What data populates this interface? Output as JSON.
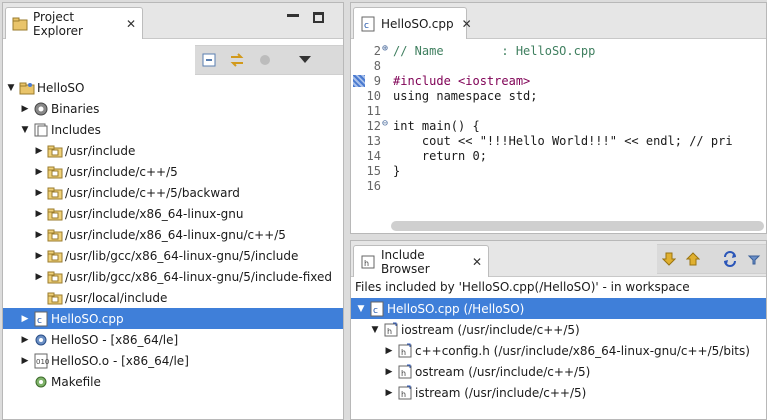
{
  "project_explorer": {
    "title": "Project Explorer",
    "tree": [
      {
        "label": "HelloSO",
        "arrow": "▼",
        "icon": "project-folder-icon",
        "depth": 0
      },
      {
        "label": "Binaries",
        "arrow": "▶",
        "icon": "binaries-icon",
        "depth": 1
      },
      {
        "label": "Includes",
        "arrow": "▼",
        "icon": "includes-icon",
        "depth": 1
      },
      {
        "label": "/usr/include",
        "arrow": "▶",
        "icon": "include-folder-icon",
        "depth": 2
      },
      {
        "label": "/usr/include/c++/5",
        "arrow": "▶",
        "icon": "include-folder-icon",
        "depth": 2
      },
      {
        "label": "/usr/include/c++/5/backward",
        "arrow": "▶",
        "icon": "include-folder-icon",
        "depth": 2
      },
      {
        "label": "/usr/include/x86_64-linux-gnu",
        "arrow": "▶",
        "icon": "include-folder-icon",
        "depth": 2
      },
      {
        "label": "/usr/include/x86_64-linux-gnu/c++/5",
        "arrow": "▶",
        "icon": "include-folder-icon",
        "depth": 2
      },
      {
        "label": "/usr/lib/gcc/x86_64-linux-gnu/5/include",
        "arrow": "▶",
        "icon": "include-folder-icon",
        "depth": 2
      },
      {
        "label": "/usr/lib/gcc/x86_64-linux-gnu/5/include-fixed",
        "arrow": "▶",
        "icon": "include-folder-icon",
        "depth": 2
      },
      {
        "label": "/usr/local/include",
        "arrow": "",
        "icon": "include-folder-icon",
        "depth": 2
      },
      {
        "label": "HelloSO.cpp",
        "arrow": "▶",
        "icon": "cpp-file-icon",
        "depth": 1,
        "selected": true
      },
      {
        "label": "HelloSO - [x86_64/le]",
        "arrow": "▶",
        "icon": "binary-gear-icon",
        "depth": 1
      },
      {
        "label": "HelloSO.o - [x86_64/le]",
        "arrow": "▶",
        "icon": "object-file-icon",
        "depth": 1
      },
      {
        "label": "Makefile",
        "arrow": "",
        "icon": "makefile-icon",
        "depth": 1
      }
    ]
  },
  "editor": {
    "tab_title": "HelloSO.cpp",
    "lines": [
      {
        "num": "2",
        "fold": "⊕",
        "text": "// Name        : HelloSO.cpp"
      },
      {
        "num": "8",
        "fold": "",
        "text": ""
      },
      {
        "num": "9",
        "fold": "",
        "text": "#include <iostream>"
      },
      {
        "num": "10",
        "fold": "",
        "text": "using namespace std;"
      },
      {
        "num": "11",
        "fold": "",
        "text": ""
      },
      {
        "num": "12",
        "fold": "⊖",
        "text": "int main() {"
      },
      {
        "num": "13",
        "fold": "",
        "text": "    cout << \"!!!Hello World!!!\" << endl; // pri"
      },
      {
        "num": "14",
        "fold": "",
        "text": "    return 0;"
      },
      {
        "num": "15",
        "fold": "",
        "text": "}"
      },
      {
        "num": "16",
        "fold": "",
        "text": ""
      }
    ]
  },
  "include_browser": {
    "title": "Include Browser",
    "status": "Files included by 'HelloSO.cpp(/HelloSO)' - in workspace",
    "tree": [
      {
        "label": "HelloSO.cpp (/HelloSO)",
        "arrow": "▼",
        "icon": "cpp-file-icon",
        "depth": 0,
        "selected": true
      },
      {
        "label": "iostream (/usr/include/c++/5)",
        "arrow": "▼",
        "icon": "header-file-icon",
        "depth": 1
      },
      {
        "label": "c++config.h (/usr/include/x86_64-linux-gnu/c++/5/bits)",
        "arrow": "▶",
        "icon": "header-file-icon",
        "depth": 2
      },
      {
        "label": "ostream (/usr/include/c++/5)",
        "arrow": "▶",
        "icon": "header-file-icon",
        "depth": 2
      },
      {
        "label": "istream (/usr/include/c++/5)",
        "arrow": "▶",
        "icon": "header-file-icon",
        "depth": 2
      }
    ]
  },
  "colors": {
    "selection": "#3f7fd9",
    "keyword": "#7f0055",
    "string": "#2a00ff",
    "comment": "#3f7f5f"
  }
}
